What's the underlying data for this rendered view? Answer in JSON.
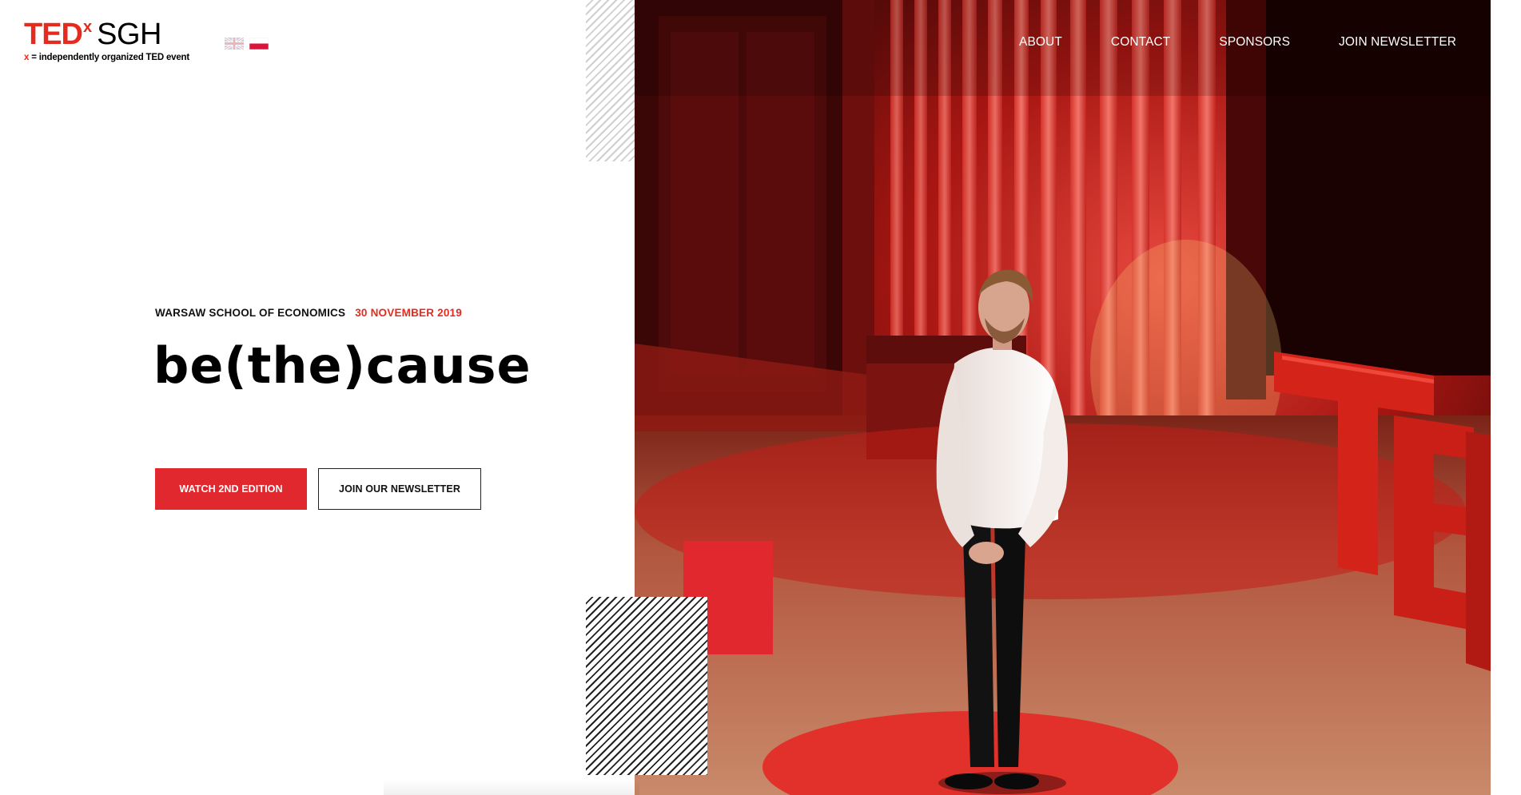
{
  "logo": {
    "ted": "TED",
    "x": "x",
    "event": "SGH",
    "tagline_x": "x",
    "tagline_rest": " = independently organized TED event"
  },
  "flags": [
    {
      "name": "english-flag-icon"
    },
    {
      "name": "polish-flag-icon"
    }
  ],
  "nav": {
    "about": "ABOUT",
    "contact": "CONTACT",
    "sponsors": "SPONSORS",
    "join_newsletter": "JOIN NEWSLETTER"
  },
  "hero": {
    "school": "WARSAW SCHOOL OF ECONOMICS",
    "date": "30 NOVEMBER 2019",
    "headline": "be(the)cause",
    "watch_button": "WATCH 2ND EDITION",
    "newsletter_button": "JOIN OUR NEWSLETTER"
  },
  "colors": {
    "brand_red": "#e62b1e",
    "button_red": "#e0282e",
    "text_dark": "#111111",
    "nav_text": "#ffffff"
  }
}
